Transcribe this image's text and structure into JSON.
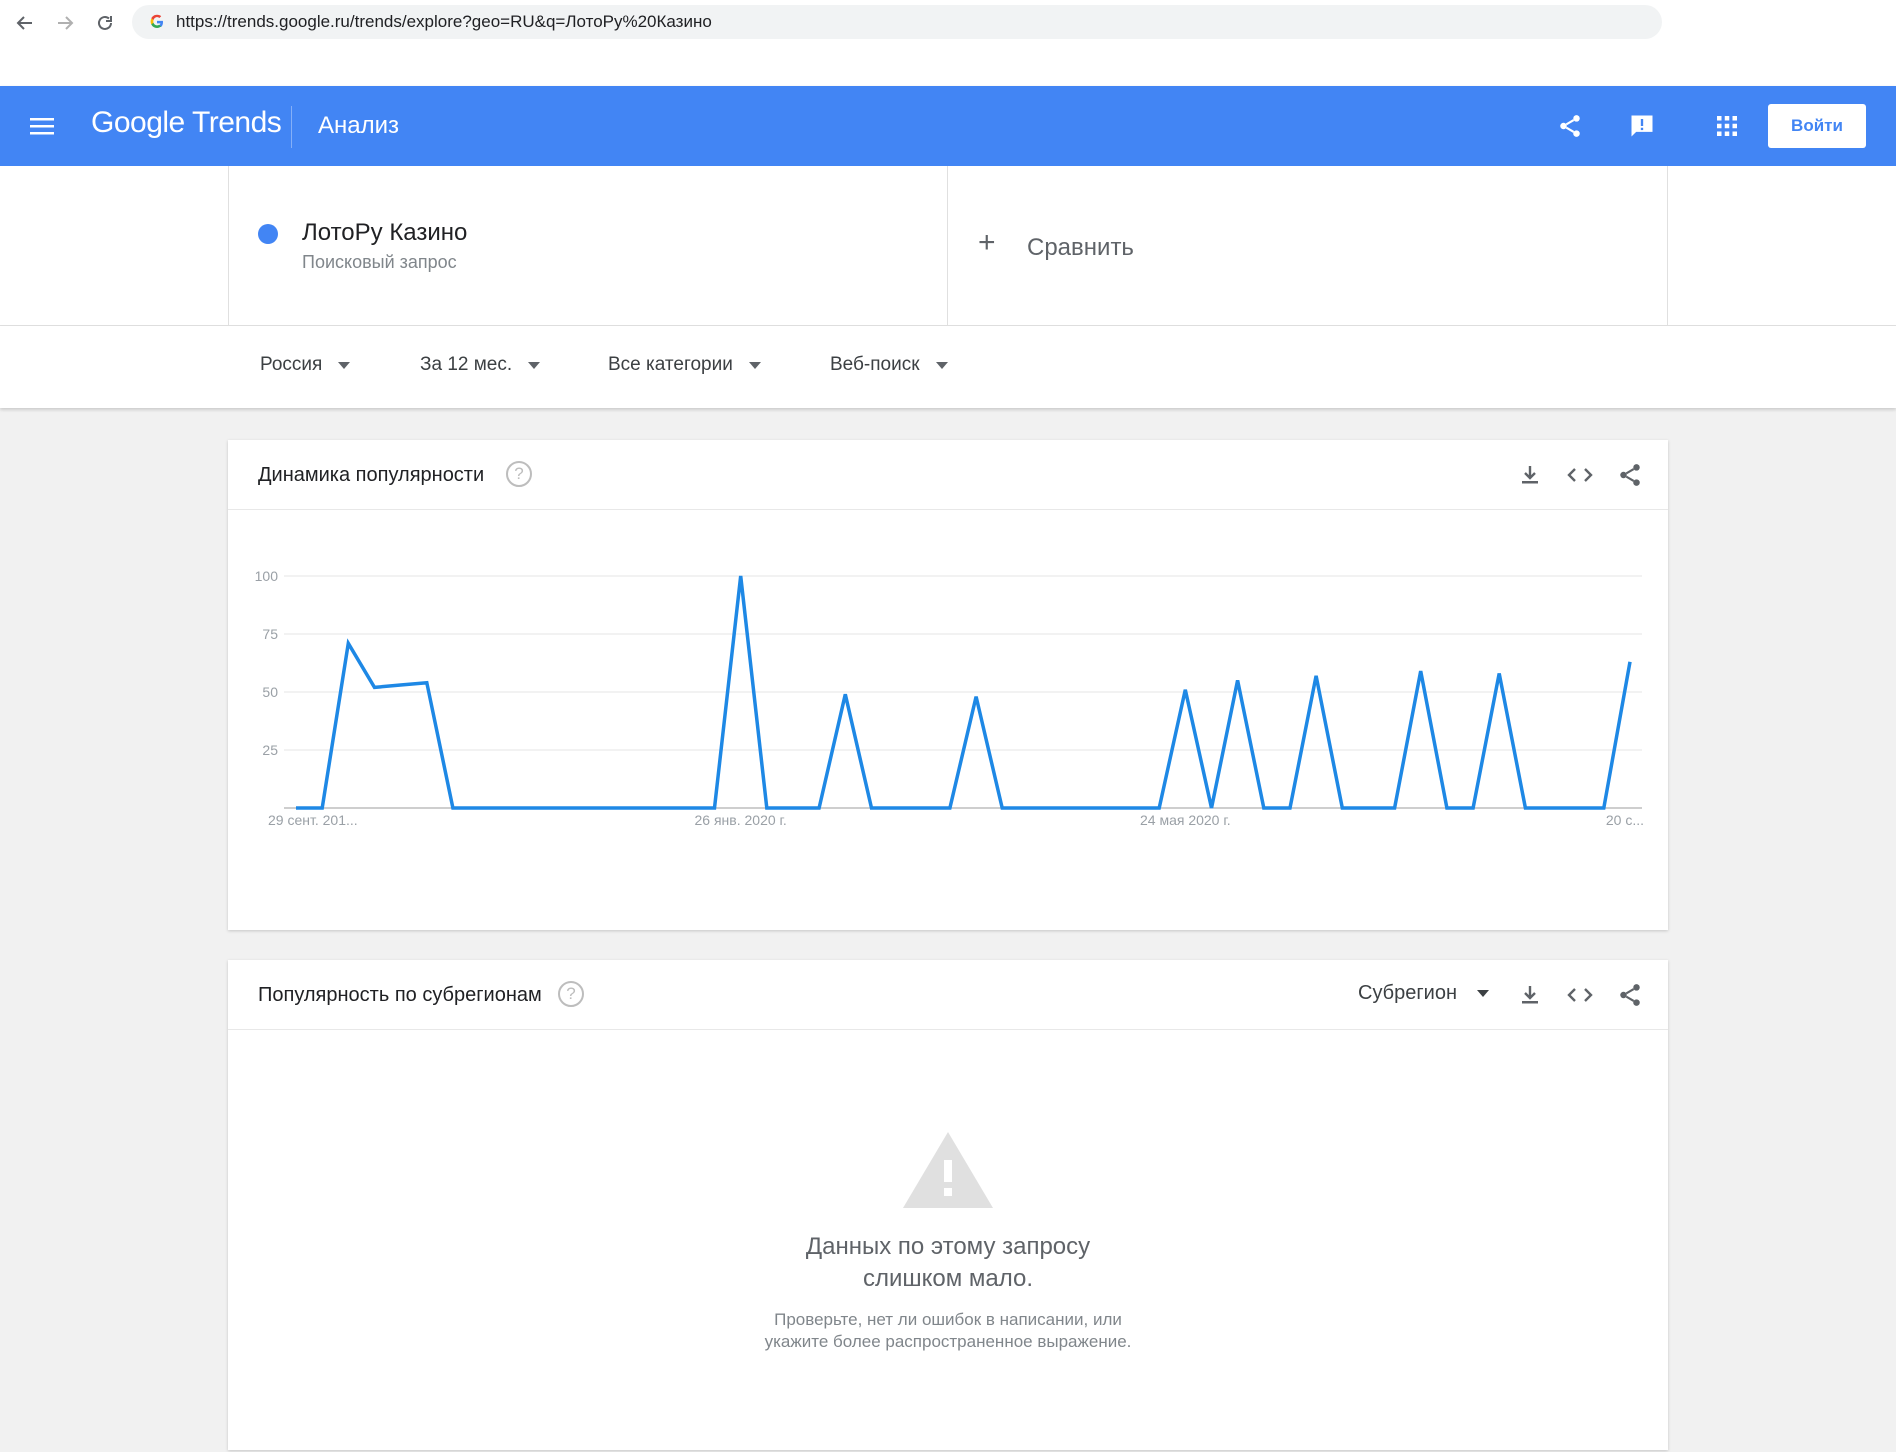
{
  "browser": {
    "url": "https://trends.google.ru/trends/explore?geo=RU&q=ЛотоРу%20Казино"
  },
  "header": {
    "logo": "Google Trends",
    "page_title": "Анализ",
    "signin_label": "Войти",
    "background_color": "#4285f4"
  },
  "terms": {
    "term_name": "ЛотоРу Казино",
    "term_type": "Поисковый запрос",
    "term_color": "#4285f4",
    "compare_label": "Сравнить"
  },
  "filters": {
    "region": "Россия",
    "period": "За 12 мес.",
    "category": "Все категории",
    "search_type": "Веб-поиск"
  },
  "interest_card": {
    "title": "Динамика популярности",
    "help": "?"
  },
  "chart_data": {
    "type": "line",
    "title": "Динамика популярности",
    "xlabel": "",
    "ylabel": "",
    "ylim": [
      0,
      100
    ],
    "yticks": [
      0,
      25,
      50,
      75,
      100
    ],
    "ytick_labels": [
      "",
      "25",
      "50",
      "75",
      "100"
    ],
    "xtick_labels": [
      {
        "index": 0,
        "label": "29 сент. 201..."
      },
      {
        "index": 17,
        "label": "26 янв. 2020 г."
      },
      {
        "index": 34,
        "label": "24 мая 2020 г."
      },
      {
        "index": 51,
        "label": "20 с..."
      }
    ],
    "grid": true,
    "series": [
      {
        "color": "#1e88e5",
        "values": [
          0,
          0,
          71,
          52,
          53,
          54,
          0,
          0,
          0,
          0,
          0,
          0,
          0,
          0,
          0,
          0,
          0,
          100,
          0,
          0,
          0,
          49,
          0,
          0,
          0,
          0,
          48,
          0,
          0,
          0,
          0,
          0,
          0,
          0,
          51,
          0,
          55,
          0,
          0,
          57,
          0,
          0,
          0,
          59,
          0,
          0,
          58,
          0,
          0,
          0,
          0,
          63
        ]
      }
    ]
  },
  "subregion_card": {
    "title": "Популярность по субрегионам",
    "help": "?",
    "select_label": "Субрегион",
    "warning_title_line1": "Данных по этому запросу",
    "warning_title_line2": "слишком мало.",
    "warning_sub_line1": "Проверьте, нет ли ошибок в написании, или",
    "warning_sub_line2": "укажите более распространенное выражение."
  }
}
